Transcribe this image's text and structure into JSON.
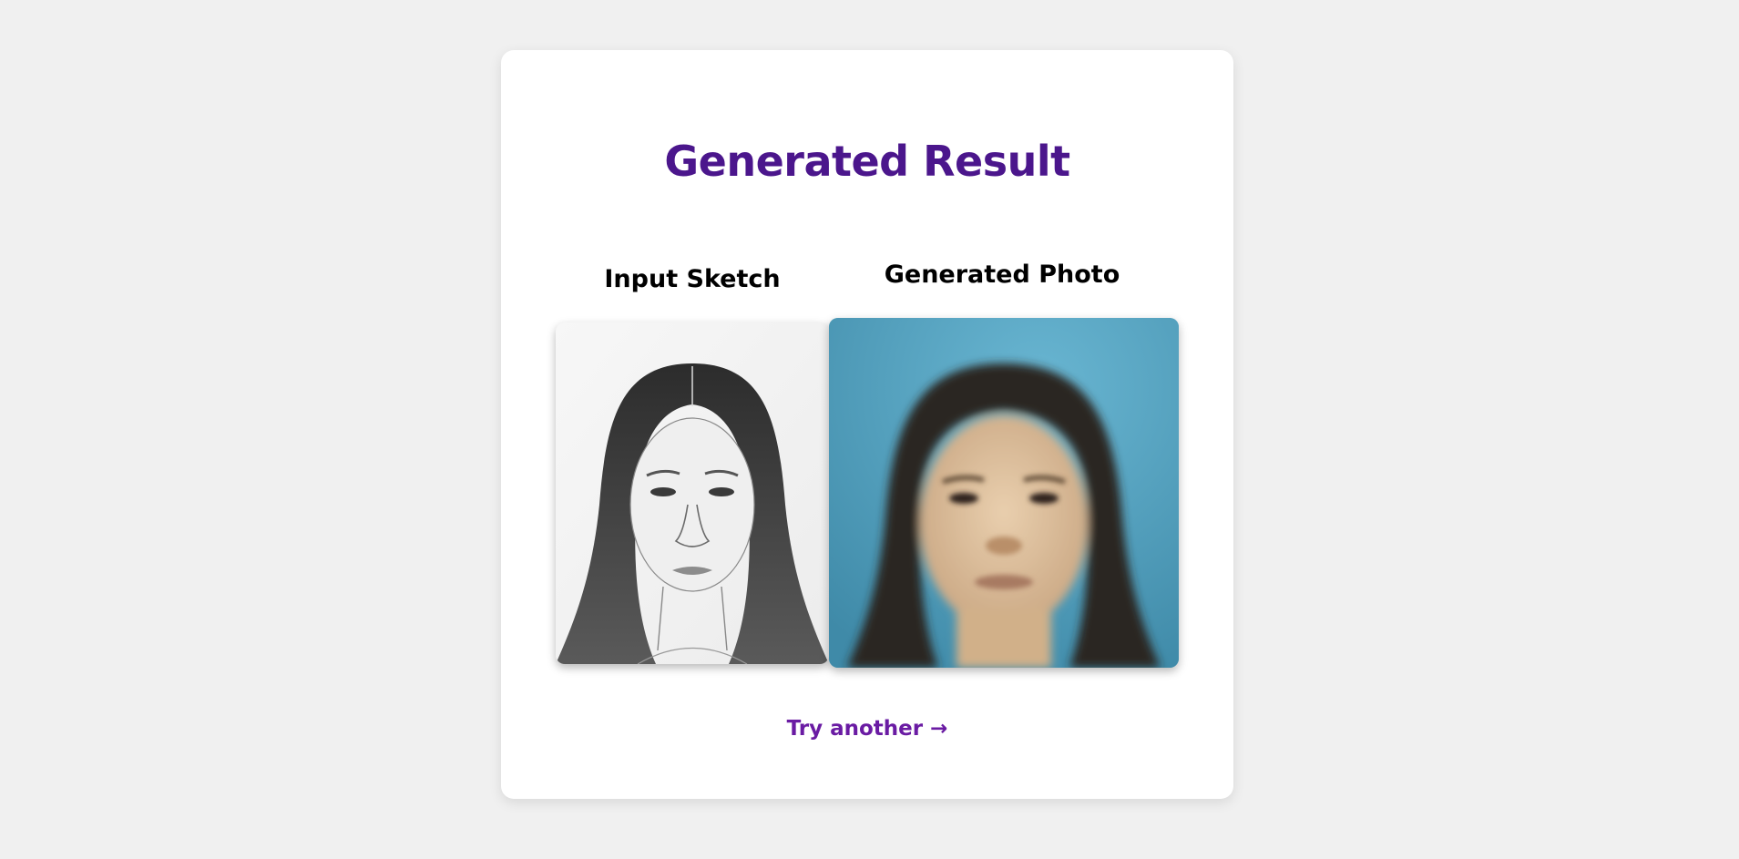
{
  "page": {
    "title": "Generated Result"
  },
  "sketch": {
    "label": "Input Sketch",
    "image_name": "sketch-portrait"
  },
  "photo": {
    "label": "Generated Photo",
    "image_name": "generated-portrait"
  },
  "actions": {
    "try_another": "Try another →"
  },
  "colors": {
    "background": "#f0f0f0",
    "card": "#ffffff",
    "title": "#4b168c",
    "link": "#6a1ba3",
    "photo_background": "#55a7c4"
  }
}
